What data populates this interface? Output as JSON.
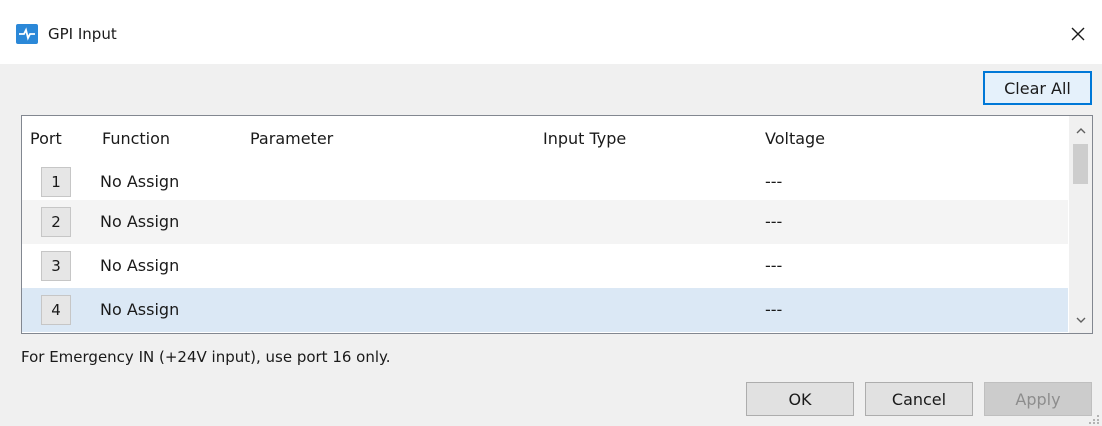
{
  "window": {
    "title": "GPI Input",
    "app_icon": "gpi-app-icon",
    "close_icon": "close-icon"
  },
  "toolbar": {
    "clear_all_label": "Clear All"
  },
  "table": {
    "columns": [
      "Port",
      "Function",
      "Parameter",
      "Input Type",
      "Voltage"
    ],
    "rows": [
      {
        "port": "1",
        "function": "No Assign",
        "parameter": "",
        "input_type": "",
        "voltage": "---"
      },
      {
        "port": "2",
        "function": "No Assign",
        "parameter": "",
        "input_type": "",
        "voltage": "---"
      },
      {
        "port": "3",
        "function": "No Assign",
        "parameter": "",
        "input_type": "",
        "voltage": "---"
      },
      {
        "port": "4",
        "function": "No Assign",
        "parameter": "",
        "input_type": "",
        "voltage": "---"
      }
    ],
    "selected_row": 4,
    "scroll_up_icon": "chevron-up-icon",
    "scroll_down_icon": "chevron-down-icon"
  },
  "note": "For Emergency IN (+24V input), use port 16 only.",
  "footer": {
    "ok_label": "OK",
    "cancel_label": "Cancel",
    "apply_label": "Apply",
    "apply_enabled": false
  },
  "colors": {
    "accent": "#0078d7",
    "selected_row": "#dbe8f5",
    "app_icon": "#2b88d8"
  }
}
